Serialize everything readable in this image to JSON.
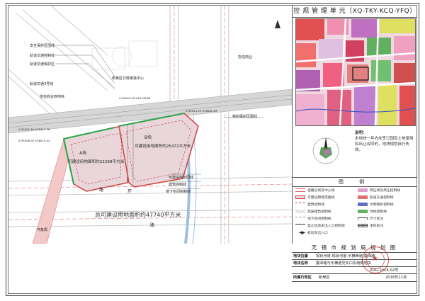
{
  "control_unit": {
    "title": "控 规 管 理 单 元（XQ-TKY-KCQ-YFQ）"
  },
  "notes": {
    "label": "说明：",
    "text": "本地块一年内未签订国有土地使用权出让合同的，地块规划自行失效。"
  },
  "map": {
    "total_area_text": "总可建设用地面积约47740平方米",
    "parcel_a": {
      "id": "A块",
      "area_text": "可建设用地面积约22268平方米"
    },
    "parcel_b": {
      "id": "B块",
      "area_text": "可建设用地面积约25472平方米"
    },
    "place_labels": [
      "新吴区行政审批中心",
      "协信商业",
      "气象局",
      "协信商业西地块"
    ],
    "line_labels": [
      "安全保护区围线",
      "轨道交通控制线",
      "轨道交通保护区",
      "特别保护区围线",
      "可建设用地围线",
      "建筑控制线",
      "地下空间控制线",
      "轨道交通3号线"
    ],
    "road_chars": [
      "环",
      "路",
      "路"
    ],
    "coords": [
      "X:35001.39 Y:38417.78",
      "X:36109.39 Y:40178.80",
      "X:35006.00 Y:38010.44",
      "X:35010.00 Y:40800.63"
    ]
  },
  "legend": {
    "title": "图 例",
    "left": [
      {
        "label": "道路红线及中心线",
        "color": "#e06060",
        "style": "double"
      },
      {
        "label": "可建设用地范围线",
        "color": "#d04040",
        "style": "fill-pink"
      },
      {
        "label": "建筑控制线",
        "color": "#d04040",
        "style": "dash"
      },
      {
        "label": "高层建筑控制线",
        "color": "#999999",
        "style": "hatch"
      },
      {
        "label": "地下空间控制线",
        "color": "#888888",
        "style": "dash-gray"
      },
      {
        "label": "禁止机动车出入口控制线",
        "color": "#333333",
        "style": "solid"
      },
      {
        "label": "机动车出入口",
        "color": "#222222",
        "style": "arrow"
      }
    ],
    "right": [
      {
        "label": "高压线及高压控制线",
        "color": "#e0a0d0",
        "style": "fill"
      },
      {
        "label": "轨道交通控制线",
        "color": "#e07070",
        "style": "fill"
      },
      {
        "label": "文物保护控制线",
        "color": "#6070c0",
        "style": "fill"
      },
      {
        "label": "绿线控制线",
        "color": "#60b060",
        "style": "fill"
      },
      {
        "label": "尺寸标注",
        "color": "#444444",
        "style": "dim"
      },
      {
        "label": "坐标标注",
        "color": "#444444",
        "style": "grid"
      }
    ]
  },
  "title_block": {
    "bureau": "无 锡 市 规 划 局 规 划 图",
    "rows": [
      {
        "key": "地块位置",
        "value": "现状河道-现状河道-乐横西道-震泽路"
      },
      {
        "key": "地块名称",
        "value": "震泽路与乐横道交叉口东南侧地块"
      },
      {
        "key": "所属行政区",
        "value": "新吴区"
      }
    ],
    "number": "XDG-2018-02号",
    "date": "2018年11月"
  },
  "colors": {
    "parcel_fill": "#e9d6da",
    "parcel_outline": "#d84848",
    "green_edge": "#2aa64a",
    "road_line": "#bdbdbd",
    "rail_fill": "#c8c8c8",
    "water": "#a8c8e8"
  }
}
